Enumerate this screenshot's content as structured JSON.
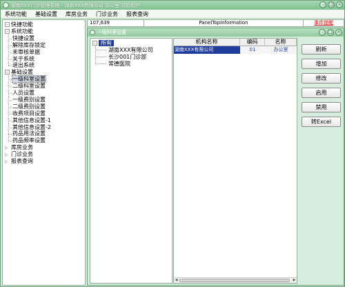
{
  "window": {
    "title": "湖南XXX门诊管理系统 - 湖南XXX有限公司 办公室 试用用户"
  },
  "menubar": [
    "系统功能",
    "基础设置",
    "库房业务",
    "门诊业务",
    "报表查询"
  ],
  "left_tree": {
    "items": [
      {
        "label": "快捷功能",
        "level": 0,
        "expander": "-"
      },
      {
        "label": "系统功能",
        "level": 0,
        "expander": "-"
      },
      {
        "label": "快捷设置",
        "level": 1
      },
      {
        "label": "解除库存锁定",
        "level": 1
      },
      {
        "label": "未审核单据",
        "level": 1
      },
      {
        "label": "关于系统",
        "level": 1
      },
      {
        "label": "退出系统",
        "level": 1
      },
      {
        "label": "基础设置",
        "level": 0,
        "expander": "-"
      },
      {
        "label": "一级科室设置",
        "level": 1,
        "selected": true
      },
      {
        "label": "二级科室设置",
        "level": 1
      },
      {
        "label": "人员设置",
        "level": 1
      },
      {
        "label": "一级费别设置",
        "level": 1
      },
      {
        "label": "二级费别设置",
        "level": 1
      },
      {
        "label": "收费项目设置",
        "level": 1
      },
      {
        "label": "其他信息设置-1",
        "level": 1
      },
      {
        "label": "其他信息设置-2",
        "level": 1
      },
      {
        "label": "药品用法设置",
        "level": 1
      },
      {
        "label": "药品频率设置",
        "level": 1
      },
      {
        "label": "库房业务",
        "level": 0,
        "expander": "▷"
      },
      {
        "label": "门诊业务",
        "level": 0,
        "expander": "▷"
      },
      {
        "label": "报表查询",
        "level": 0,
        "expander": "▷"
      }
    ]
  },
  "status": {
    "left": "107,639",
    "center": "PanelTopInformation",
    "right": "事件提醒"
  },
  "child": {
    "title": "一级科室设置",
    "org_tree": [
      {
        "label": "所有",
        "level": 0,
        "selected": true
      },
      {
        "label": "湖南XXX有限公司",
        "level": 1
      },
      {
        "label": "长沙001门诊部",
        "level": 1
      },
      {
        "label": "常德医院",
        "level": 1
      }
    ],
    "table": {
      "columns": [
        "机构名称",
        "编码",
        "名称"
      ],
      "rows": [
        [
          "湖南XXX有限公司",
          "01",
          "办公室"
        ]
      ]
    },
    "buttons": [
      "刷新",
      "增加",
      "修改",
      "启用",
      "禁用",
      "转Excel"
    ]
  }
}
